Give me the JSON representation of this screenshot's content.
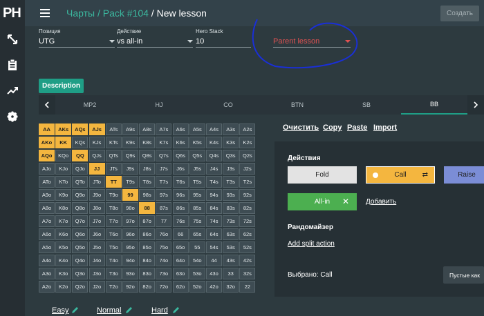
{
  "sidebar": {
    "logo": "PH",
    "icons": [
      "shrink-arrows-icon",
      "clipboard-icon",
      "trending-up-icon",
      "gear-icon"
    ]
  },
  "header": {
    "breadcrumb": [
      {
        "label": "Чарты",
        "link": true
      },
      {
        "label": " / ",
        "link": false
      },
      {
        "label": "Pack #104",
        "link": true
      },
      {
        "label": " / ",
        "link": false
      },
      {
        "label": "New lesson",
        "link": false
      }
    ],
    "create_label": "Создать"
  },
  "fields": {
    "position": {
      "label": "Позиция",
      "value": "UTG"
    },
    "action": {
      "label": "Действие",
      "value": "vs all-in"
    },
    "stack": {
      "label": "Hero Stack",
      "value": "10"
    },
    "parent": {
      "placeholder": "Parent lesson"
    }
  },
  "description_label": "Description",
  "tabs": [
    "MP2",
    "HJ",
    "CO",
    "BTN",
    "SB",
    "BB"
  ],
  "active_tab": "BB",
  "grid_actions": [
    "Очистить",
    "Copy",
    "Paste",
    "Import"
  ],
  "grid": {
    "call_hands": [
      "AA",
      "AKs",
      "AQs",
      "AJs",
      "AKo",
      "KK",
      "AQo",
      "QQ",
      "JJ",
      "TT",
      "99",
      "88"
    ]
  },
  "panel": {
    "title_actions": "Действия",
    "fold_label": "Fold",
    "call_label": "Call",
    "raise_label": "Raise",
    "allin_label": "All-in",
    "add_label": "Добавить",
    "randomizer_label": "Рандомайзер",
    "add_split_label": "Add split action",
    "selected_label": "Выбрано: Call",
    "empty_label": "Пустые как"
  },
  "difficulty": [
    "Easy",
    "Normal",
    "Hard"
  ],
  "colors": {
    "accent": "#1f9e86",
    "call": "#f4b63f",
    "fold": "#e3e3e3",
    "raise": "#7b8dd6",
    "allin": "#4caf50",
    "annotation": "#1a2fd6"
  }
}
